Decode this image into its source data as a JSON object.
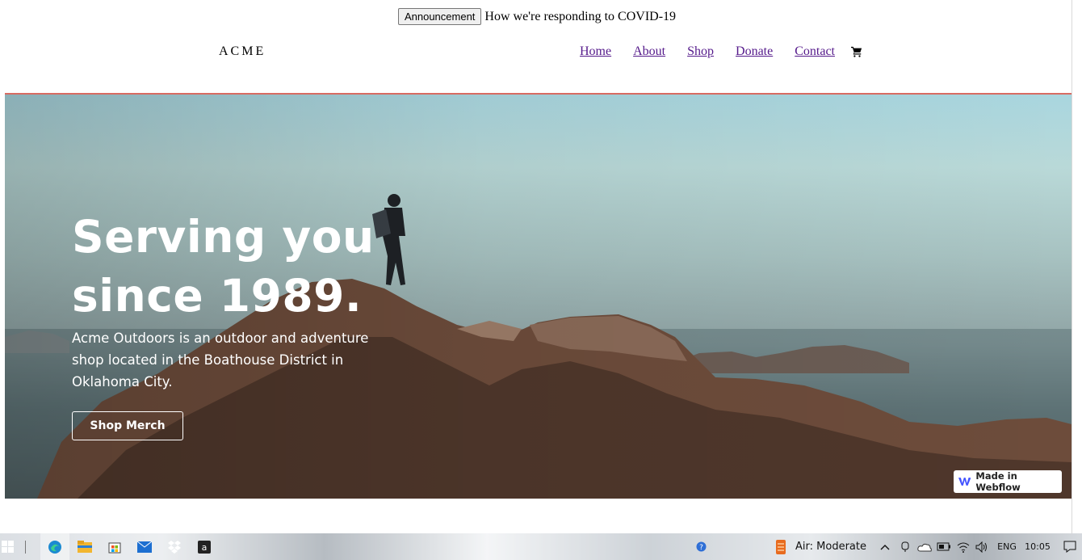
{
  "announcement": {
    "button_label": "Announcement",
    "text": "How we're responding to COVID-19"
  },
  "header": {
    "brand": "ACME",
    "nav": [
      "Home",
      "About",
      "Shop",
      "Donate",
      "Contact"
    ]
  },
  "hero": {
    "title_line1": "Serving you",
    "title_line2": "since 1989.",
    "description": "Acme Outdoors is an outdoor and adventure shop located in the Boathouse District in Oklahoma City.",
    "cta_label": "Shop Merch"
  },
  "badge": {
    "label": "Made in Webflow"
  },
  "colors": {
    "accent_line": "#d86b62",
    "link": "#551a8b"
  },
  "taskbar": {
    "icons": [
      "windows-start-icon",
      "edge-icon",
      "file-explorer-icon",
      "store-icon",
      "mail-icon",
      "dropbox-icon",
      "amazon-icon",
      "help-icon",
      "weather-icon",
      "chevron-up-icon",
      "meet-icon",
      "onedrive-icon",
      "battery-icon",
      "wifi-icon",
      "volume-icon",
      "notification-icon"
    ],
    "weather": "Air: Moderate",
    "language": "ENG",
    "time": "10:05"
  }
}
